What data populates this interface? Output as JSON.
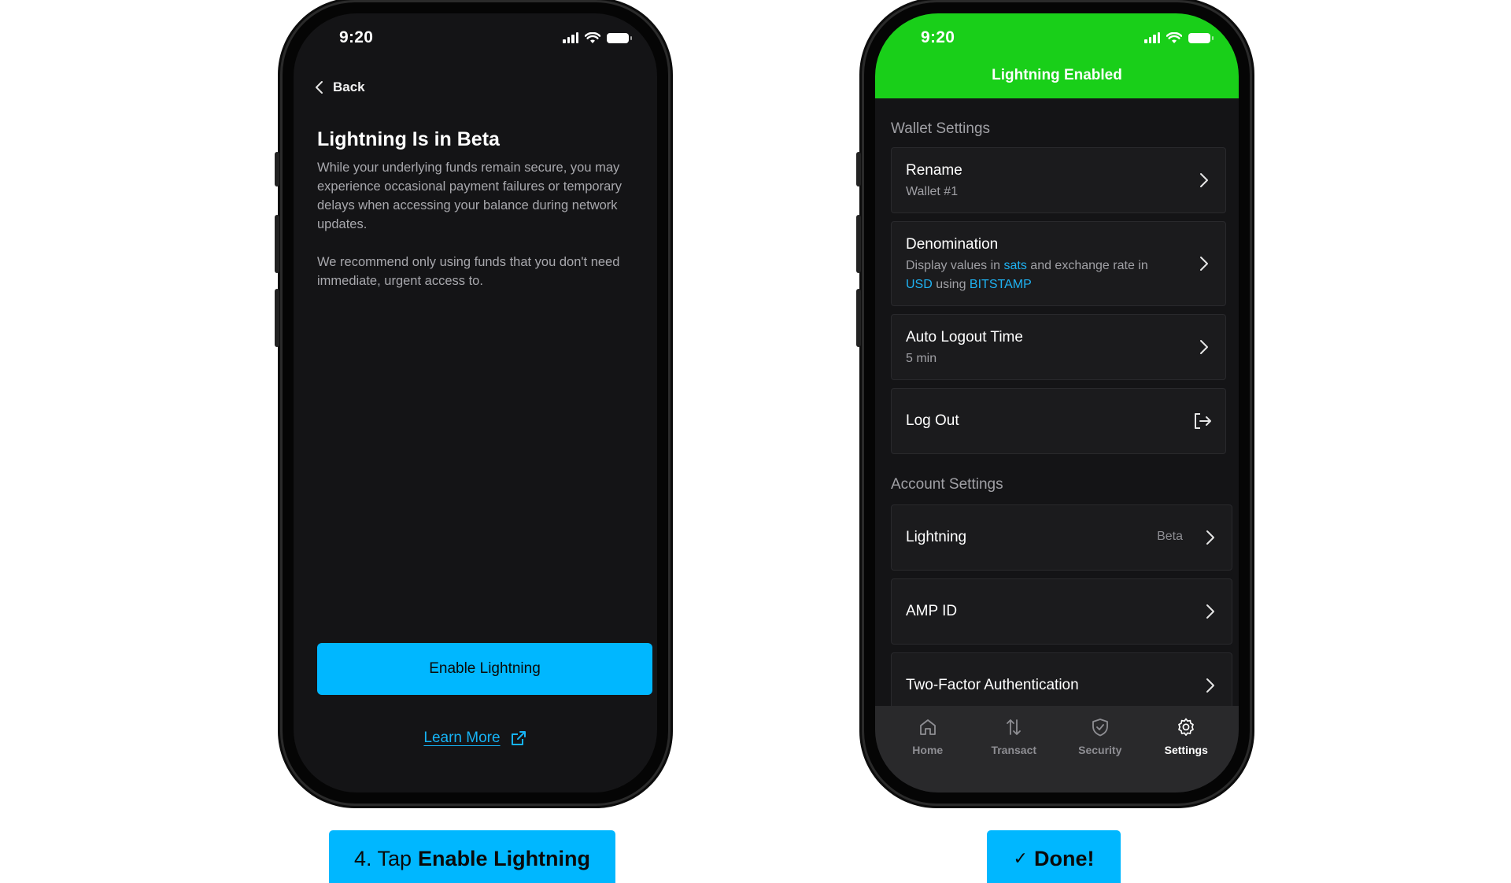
{
  "left_phone": {
    "status_time": "9:20",
    "back_label": "Back",
    "title": "Lightning Is in Beta",
    "paragraph_1": "While your underlying funds remain secure, you may experience occasional payment failures or temporary delays when accessing your balance during network updates.",
    "paragraph_2": "We recommend only using funds that you don't need immediate, urgent access to.",
    "enable_button": "Enable Lightning",
    "learn_more": "Learn More"
  },
  "right_phone": {
    "status_time": "9:20",
    "header_title": "Lightning Enabled",
    "wallet_settings": {
      "label": "Wallet Settings",
      "rename": {
        "title": "Rename",
        "value": "Wallet #1"
      },
      "denomination": {
        "title": "Denomination",
        "text_1": "Display values in ",
        "unit": "sats",
        "text_2": " and exchange rate in",
        "currency": "USD",
        "text_3": " using ",
        "source": "BITSTAMP"
      },
      "auto_logout": {
        "title": "Auto Logout Time",
        "value": "5 min"
      },
      "log_out": {
        "title": "Log Out"
      }
    },
    "account_settings": {
      "label": "Account Settings",
      "lightning": {
        "title": "Lightning",
        "tag": "Beta"
      },
      "amp_id": {
        "title": "AMP ID"
      },
      "two_factor": {
        "title": "Two-Factor Authentication"
      }
    },
    "tabs": [
      {
        "label": "Home",
        "icon": "home-icon"
      },
      {
        "label": "Transact",
        "icon": "transact-arrows-icon"
      },
      {
        "label": "Security",
        "icon": "shield-check-icon"
      },
      {
        "label": "Settings",
        "icon": "gear-icon",
        "active": true
      }
    ]
  },
  "captions": {
    "step_prefix": "4. Tap",
    "step_action": "Enable Lightning",
    "done_check": "✓",
    "done_label": "Done!"
  },
  "colors": {
    "accent_blue": "#00b7ff",
    "success_green": "#19cf19",
    "screen_bg": "#141416",
    "link_blue": "#1fb2f2"
  }
}
